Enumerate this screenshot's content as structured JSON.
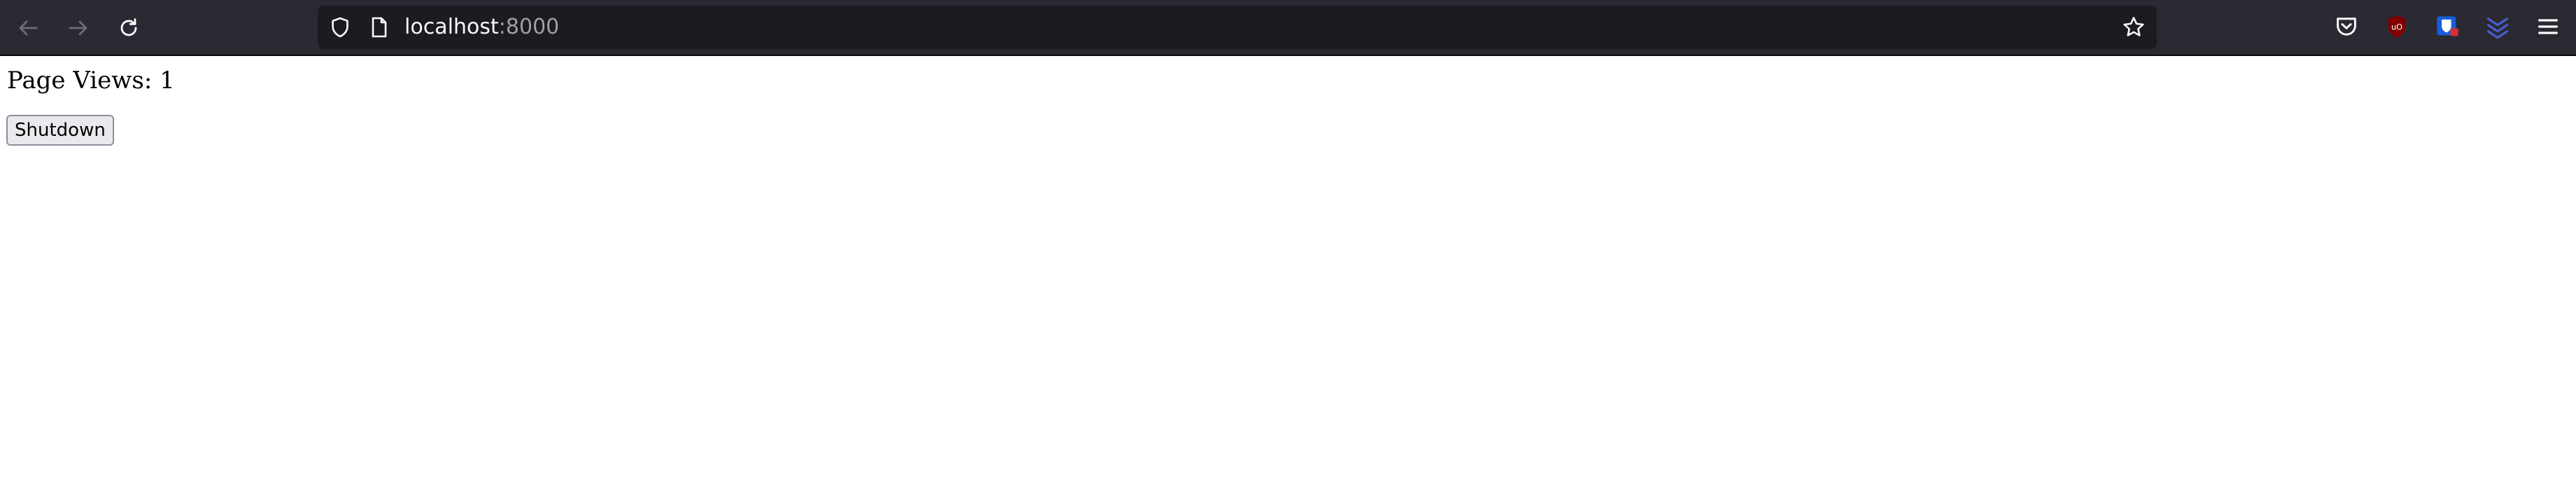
{
  "browser": {
    "url_host": "localhost",
    "url_port": ":8000",
    "icons": {
      "back": "back-arrow-icon",
      "forward": "forward-arrow-icon",
      "reload": "reload-icon",
      "tracking_protection": "shield-icon",
      "page_info": "page-icon",
      "bookmark": "star-icon",
      "pocket": "pocket-icon",
      "ublock": "ublock-origin-icon",
      "bitwarden": "bitwarden-icon",
      "extension": "chevron-stack-icon",
      "menu": "hamburger-menu-icon"
    },
    "colors": {
      "toolbar_bg": "#2b2a33",
      "urlbar_bg": "#1c1b22",
      "icon": "#fbfbfe",
      "icon_disabled": "#8f8f9d"
    }
  },
  "page": {
    "views_text": "Page Views: 1",
    "shutdown_label": "Shutdown"
  }
}
